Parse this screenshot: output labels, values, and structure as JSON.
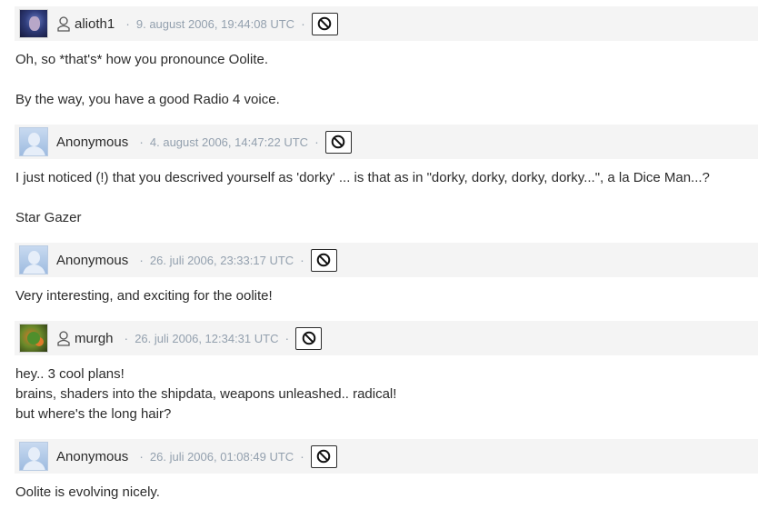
{
  "comments": [
    {
      "author": "alioth1",
      "avatar": "user-avatar",
      "registered": true,
      "timestamp": "9. august 2006, 19:44:08 UTC",
      "lines": [
        "Oh, so *that's* how you pronounce Oolite.",
        "",
        "By the way, you have a good Radio 4 voice."
      ]
    },
    {
      "author": "Anonymous",
      "avatar": "anonymous-avatar",
      "registered": false,
      "timestamp": "4. august 2006, 14:47:22 UTC",
      "lines": [
        "I just noticed (!) that you descrived yourself as 'dorky' ... is that as in \"dorky, dorky, dorky, dorky...\", a la Dice Man...?",
        "",
        "Star Gazer"
      ]
    },
    {
      "author": "Anonymous",
      "avatar": "anonymous-avatar",
      "registered": false,
      "timestamp": "26. juli 2006, 23:33:17 UTC",
      "lines": [
        "Very interesting, and exciting for the oolite!"
      ]
    },
    {
      "author": "murgh",
      "avatar": "user-avatar",
      "registered": true,
      "timestamp": "26. juli 2006, 12:34:31 UTC",
      "lines": [
        "hey.. 3 cool plans!",
        "brains, shaders into the shipdata, weapons unleashed.. radical!",
        "but where's the long hair?"
      ]
    },
    {
      "author": "Anonymous",
      "avatar": "anonymous-avatar",
      "registered": false,
      "timestamp": "26. juli 2006, 01:08:49 UTC",
      "lines": [
        "Oolite is evolving nicely."
      ]
    }
  ],
  "separator": "·",
  "icons": {
    "block": "block-icon",
    "user": "user-icon"
  },
  "colors": {
    "header_bg": "#f4f4f4",
    "date": "#93a0ae",
    "text": "#2b2b2b"
  }
}
